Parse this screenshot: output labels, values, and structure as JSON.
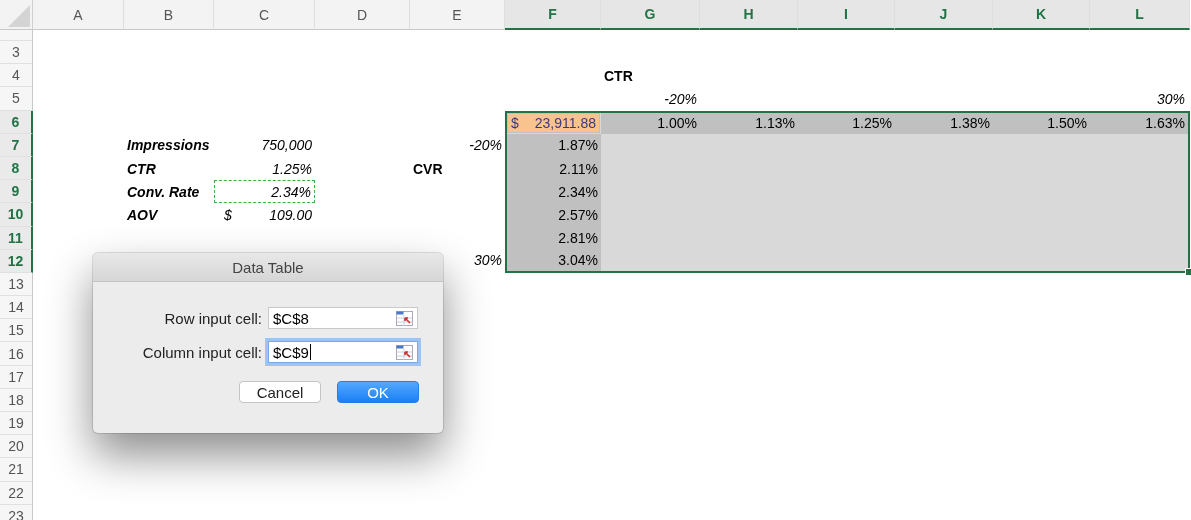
{
  "columns": [
    {
      "label": "A",
      "selected": false
    },
    {
      "label": "B",
      "selected": false
    },
    {
      "label": "C",
      "selected": false
    },
    {
      "label": "D",
      "selected": false
    },
    {
      "label": "E",
      "selected": false
    },
    {
      "label": "F",
      "selected": true
    },
    {
      "label": "G",
      "selected": true
    },
    {
      "label": "H",
      "selected": true
    },
    {
      "label": "I",
      "selected": true
    },
    {
      "label": "J",
      "selected": true
    },
    {
      "label": "K",
      "selected": true
    },
    {
      "label": "L",
      "selected": true
    }
  ],
  "rows": [
    {
      "label": "3",
      "selected": false
    },
    {
      "label": "4",
      "selected": false,
      "cells": {
        "G": {
          "kind": "header",
          "text": "CTR"
        }
      }
    },
    {
      "label": "5",
      "selected": false,
      "cells": {
        "G": {
          "kind": "italic",
          "text": "-20%"
        },
        "L": {
          "kind": "italic",
          "text": "30%"
        }
      }
    },
    {
      "label": "6",
      "selected": true,
      "cells": {
        "F": {
          "kind": "result",
          "symbol": "$",
          "text": "23,911.88"
        },
        "G": {
          "kind": "axis",
          "text": "1.00%"
        },
        "H": {
          "kind": "axis",
          "text": "1.13%"
        },
        "I": {
          "kind": "axis",
          "text": "1.25%"
        },
        "J": {
          "kind": "axis",
          "text": "1.38%"
        },
        "K": {
          "kind": "axis",
          "text": "1.50%"
        },
        "L": {
          "kind": "axis",
          "text": "1.63%"
        }
      }
    },
    {
      "label": "7",
      "selected": true,
      "cells": {
        "B": {
          "kind": "label",
          "text": "Impressions"
        },
        "C": {
          "kind": "italic",
          "text": "750,000"
        },
        "E": {
          "kind": "italic",
          "text": "-20%"
        },
        "F": {
          "kind": "axis",
          "text": "1.87%"
        }
      }
    },
    {
      "label": "8",
      "selected": true,
      "cells": {
        "B": {
          "kind": "label",
          "text": "CTR"
        },
        "C": {
          "kind": "italic",
          "text": "1.25%"
        },
        "E": {
          "kind": "header",
          "text": "CVR"
        },
        "F": {
          "kind": "axis",
          "text": "2.11%"
        }
      }
    },
    {
      "label": "9",
      "selected": true,
      "cells": {
        "B": {
          "kind": "label",
          "text": "Conv. Rate"
        },
        "C": {
          "kind": "italic",
          "text": "2.34%",
          "marquee": true
        },
        "F": {
          "kind": "axis",
          "text": "2.34%"
        }
      }
    },
    {
      "label": "10",
      "selected": true,
      "cells": {
        "B": {
          "kind": "label",
          "text": "AOV"
        },
        "C": {
          "kind": "currency",
          "symbol": "$",
          "text": "109.00"
        },
        "F": {
          "kind": "axis",
          "text": "2.57%"
        }
      }
    },
    {
      "label": "11",
      "selected": true,
      "cells": {
        "F": {
          "kind": "axis",
          "text": "2.81%"
        }
      }
    },
    {
      "label": "12",
      "selected": true,
      "cells": {
        "E": {
          "kind": "italic",
          "text": "30%"
        },
        "F": {
          "kind": "axis",
          "text": "3.04%"
        }
      }
    },
    {
      "label": "13",
      "selected": false
    },
    {
      "label": "14",
      "selected": false
    },
    {
      "label": "15",
      "selected": false
    },
    {
      "label": "16",
      "selected": false
    },
    {
      "label": "17",
      "selected": false
    },
    {
      "label": "18",
      "selected": false
    },
    {
      "label": "19",
      "selected": false
    },
    {
      "label": "20",
      "selected": false
    },
    {
      "label": "21",
      "selected": false
    },
    {
      "label": "22",
      "selected": false
    },
    {
      "label": "23",
      "selected": false
    }
  ],
  "dialog": {
    "title": "Data Table",
    "fields": [
      {
        "label": "Row input cell:",
        "value": "$C$8",
        "focused": false
      },
      {
        "label": "Column input cell:",
        "value": "$C$9",
        "focused": true
      }
    ],
    "buttons": [
      {
        "label": "Cancel",
        "kind": "secondary"
      },
      {
        "label": "OK",
        "kind": "primary"
      }
    ]
  }
}
